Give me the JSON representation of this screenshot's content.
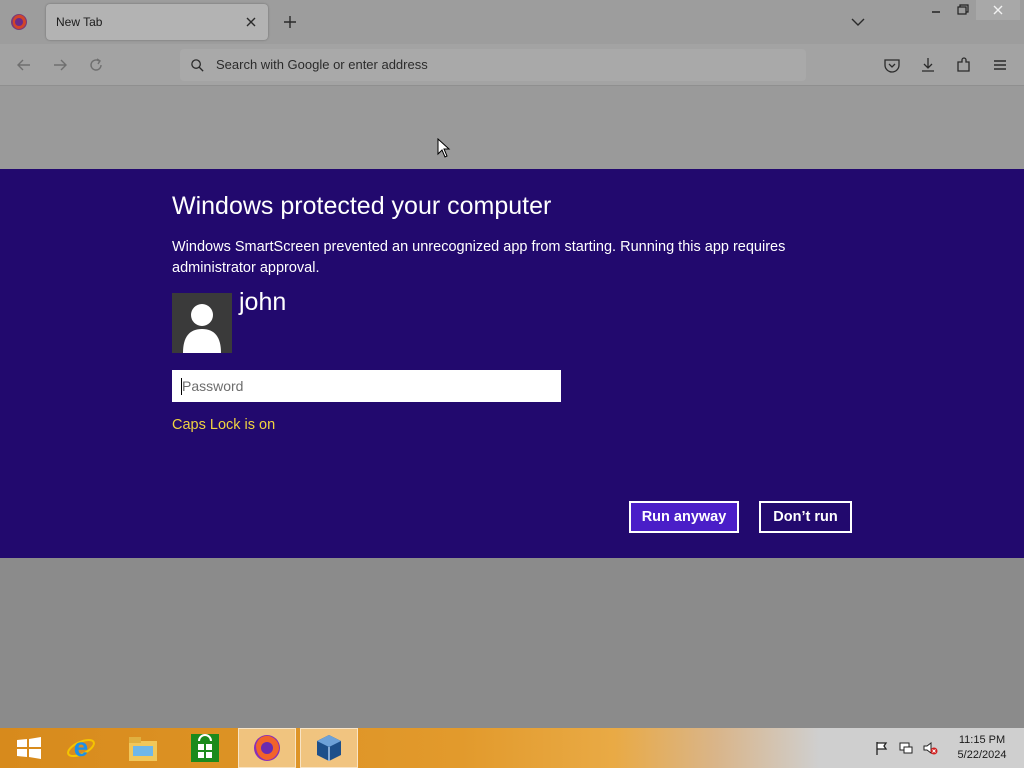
{
  "browser": {
    "tab_title": "New Tab",
    "url_placeholder": "Search with Google or enter address"
  },
  "dialog": {
    "title": "Windows protected your computer",
    "message": "Windows SmartScreen prevented an unrecognized app from starting. Running this app requires administrator approval.",
    "username": "john",
    "password_placeholder": "Password",
    "caps_lock_notice": "Caps Lock is on",
    "run_anyway_label": "Run anyway",
    "dont_run_label": "Don’t run",
    "background_color": "#22096e",
    "warning_color": "#f0d340"
  },
  "taskbar": {
    "apps": [
      "start-icon",
      "internet-explorer-icon",
      "file-explorer-icon",
      "store-icon",
      "firefox-icon",
      "virtualbox-icon"
    ],
    "active_app": "firefox-icon",
    "clock_time": "11:15 PM",
    "clock_date": "5/22/2024"
  }
}
